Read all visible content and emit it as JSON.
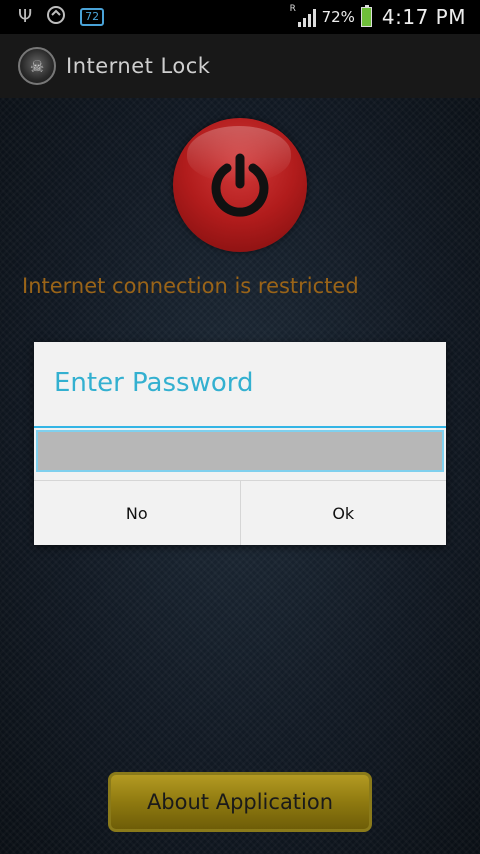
{
  "status_bar": {
    "notification_badge": "72",
    "signal_flag": "R",
    "battery_percent": "72%",
    "time": "4:17 PM",
    "icons": [
      "usb-icon",
      "sync-icon",
      "notification-badge-icon",
      "signal-icon",
      "battery-charging-icon"
    ]
  },
  "action_bar": {
    "title": "Internet Lock",
    "icon": "app-skull-icon"
  },
  "main": {
    "power_icon": "power-icon",
    "status_message": "Internet connection is restricted",
    "status_color": "#9a6418"
  },
  "dialog": {
    "title": "Enter Password",
    "input_value": "",
    "no_label": "No",
    "ok_label": "Ok",
    "accent_color": "#33b5e5"
  },
  "footer": {
    "about_label": "About Application"
  }
}
